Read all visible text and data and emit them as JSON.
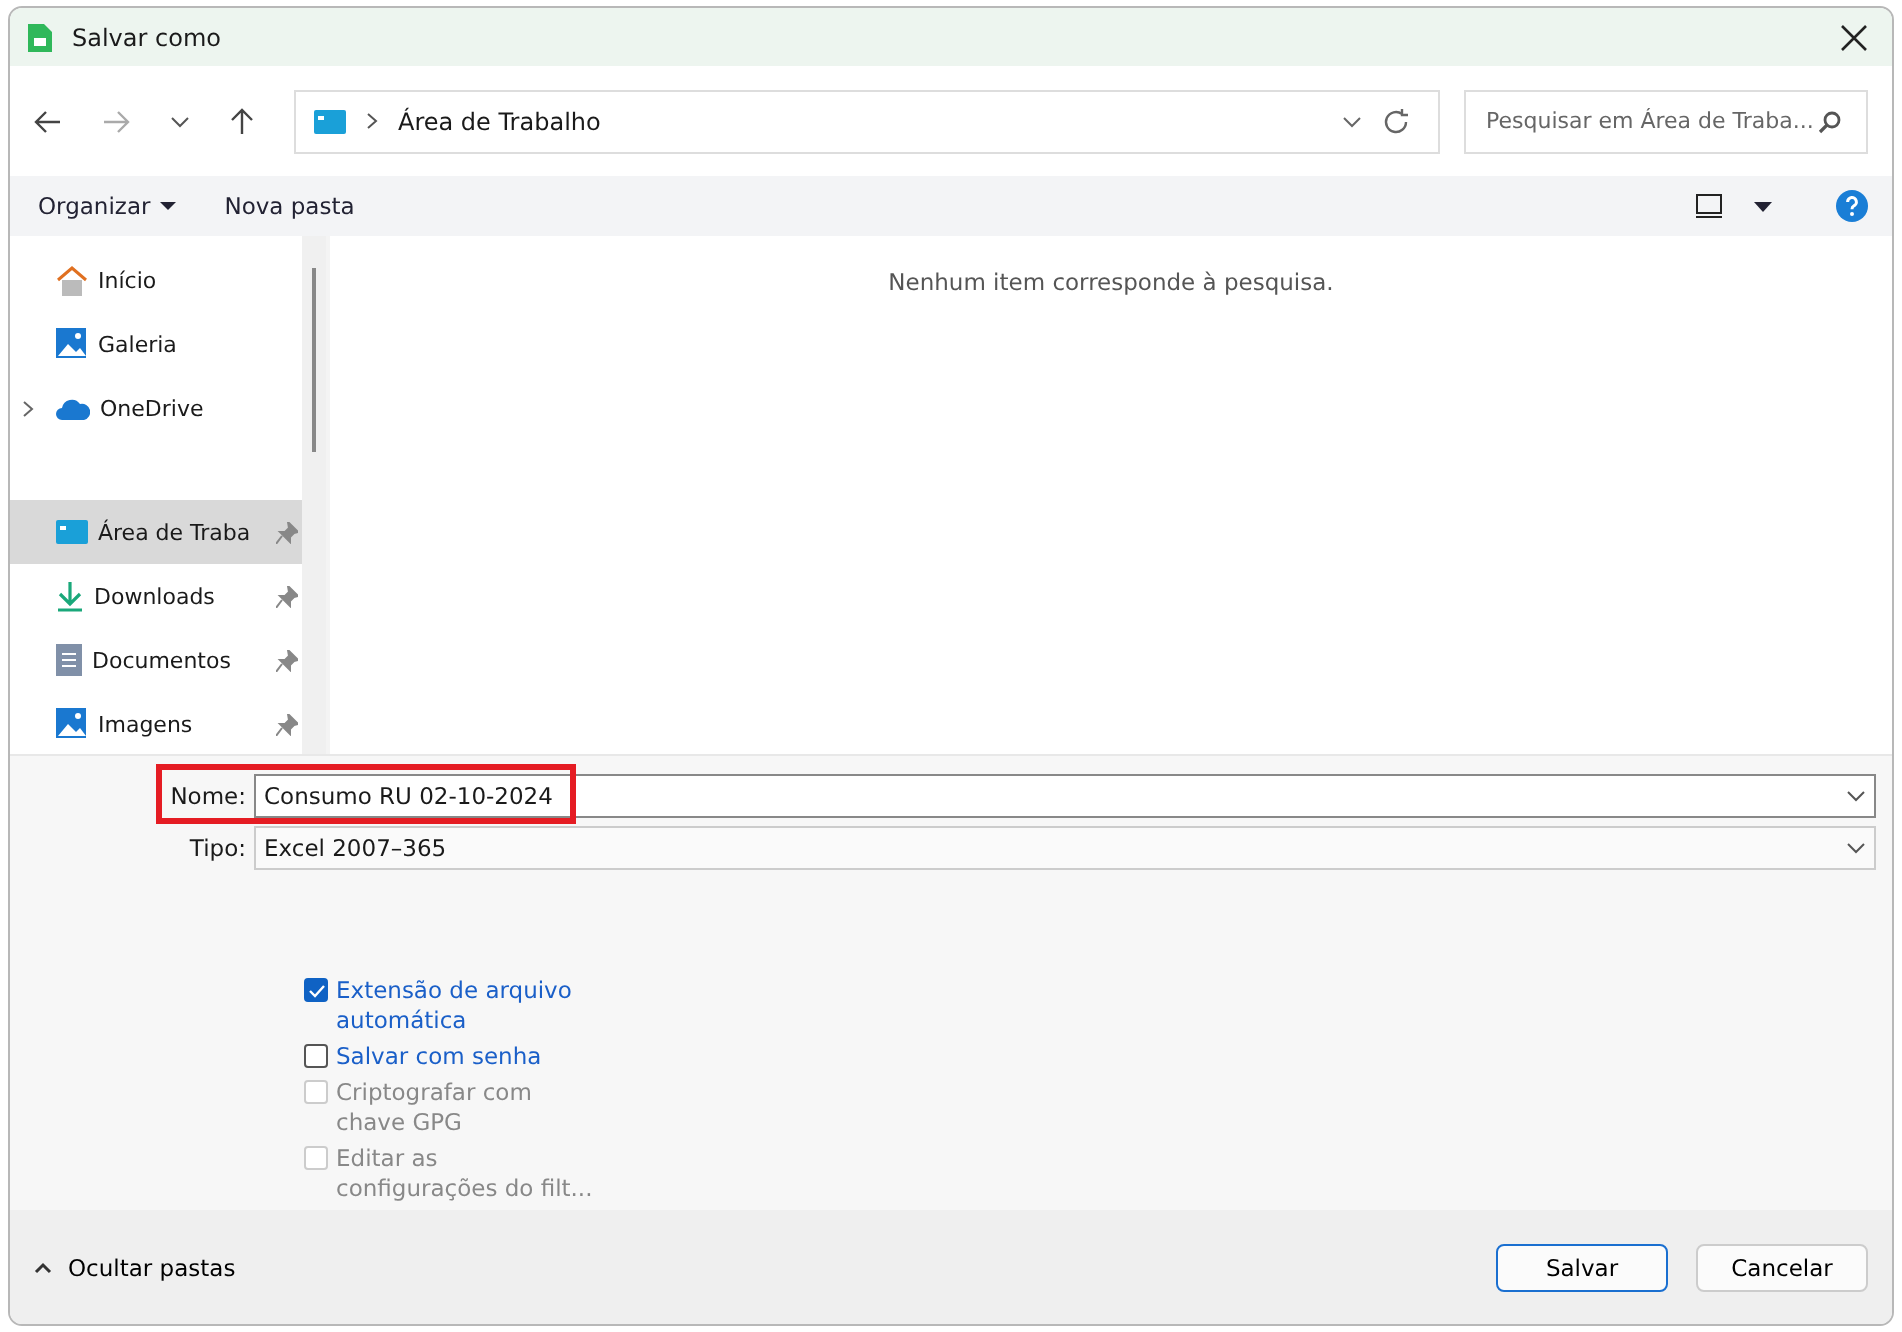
{
  "window": {
    "title": "Salvar como"
  },
  "address": {
    "location": "Área de Trabalho"
  },
  "search": {
    "placeholder": "Pesquisar em Área de Traba..."
  },
  "toolbar": {
    "organize": "Organizar",
    "new_folder": "Nova pasta"
  },
  "sidebar": {
    "sections": [
      {
        "items": [
          {
            "label": "Início",
            "kind": "home",
            "pinned": false,
            "expandable": false,
            "selected": false
          },
          {
            "label": "Galeria",
            "kind": "gallery",
            "pinned": false,
            "expandable": false,
            "selected": false
          },
          {
            "label": "OneDrive",
            "kind": "cloud",
            "pinned": false,
            "expandable": true,
            "selected": false
          }
        ]
      },
      {
        "items": [
          {
            "label": "Área de Traba",
            "kind": "desktop",
            "pinned": true,
            "expandable": false,
            "selected": true
          },
          {
            "label": "Downloads",
            "kind": "download",
            "pinned": true,
            "expandable": false,
            "selected": false
          },
          {
            "label": "Documentos",
            "kind": "document",
            "pinned": true,
            "expandable": false,
            "selected": false
          },
          {
            "label": "Imagens",
            "kind": "image",
            "pinned": true,
            "expandable": false,
            "selected": false
          }
        ]
      }
    ]
  },
  "content": {
    "empty_message": "Nenhum item corresponde à pesquisa."
  },
  "name_field": {
    "label": "Nome:",
    "value": "Consumo RU 02-10-2024",
    "highlighted": true
  },
  "type_field": {
    "label": "Tipo:",
    "value": "Excel 2007–365"
  },
  "options": [
    {
      "label": "Extensão de arquivo automática",
      "checked": true,
      "disabled": false
    },
    {
      "label": "Salvar com senha",
      "checked": false,
      "disabled": false
    },
    {
      "label": "Criptografar com chave GPG",
      "checked": false,
      "disabled": true
    },
    {
      "label": "Editar as configurações do filt...",
      "checked": false,
      "disabled": true
    }
  ],
  "footer": {
    "toggle": "Ocultar pastas",
    "save": "Salvar",
    "cancel": "Cancelar"
  }
}
